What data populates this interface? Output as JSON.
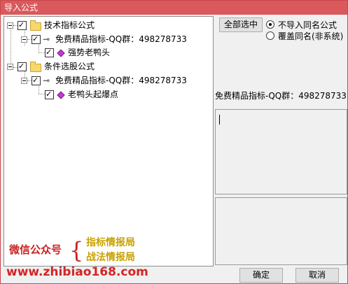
{
  "window": {
    "title": "导入公式"
  },
  "tree": {
    "groups": [
      {
        "label": "技术指标公式",
        "checked": true,
        "children": [
          {
            "label": "免费精品指标-QQ群：498278733",
            "checked": true,
            "items": [
              {
                "label": "强势老鸭头",
                "checked": true
              }
            ]
          }
        ]
      },
      {
        "label": "条件选股公式",
        "checked": true,
        "children": [
          {
            "label": "免费精品指标-QQ群：498278733",
            "checked": true,
            "items": [
              {
                "label": "老鸭头起爆点",
                "checked": true
              }
            ]
          }
        ]
      }
    ]
  },
  "watermark": {
    "wechat": "微信公众号",
    "brace": "{",
    "brand1": "指标情报局",
    "brand2": "战法情报局",
    "site": "www.zhibiao168.com",
    "colors": {
      "red": "#d42424",
      "gold": "#c9a100"
    }
  },
  "options": {
    "select_all_label": "全部选中",
    "radio_no_import": "不导入同名公式",
    "radio_overwrite": "覆盖同名(非系统)",
    "selected": "radio_no_import"
  },
  "info": {
    "label": "免费精品指标-QQ群：498278733"
  },
  "buttons": {
    "ok": "确定",
    "cancel": "取消"
  },
  "colors": {
    "titlebar": "#d9595c",
    "background": "#f0f0f0"
  }
}
